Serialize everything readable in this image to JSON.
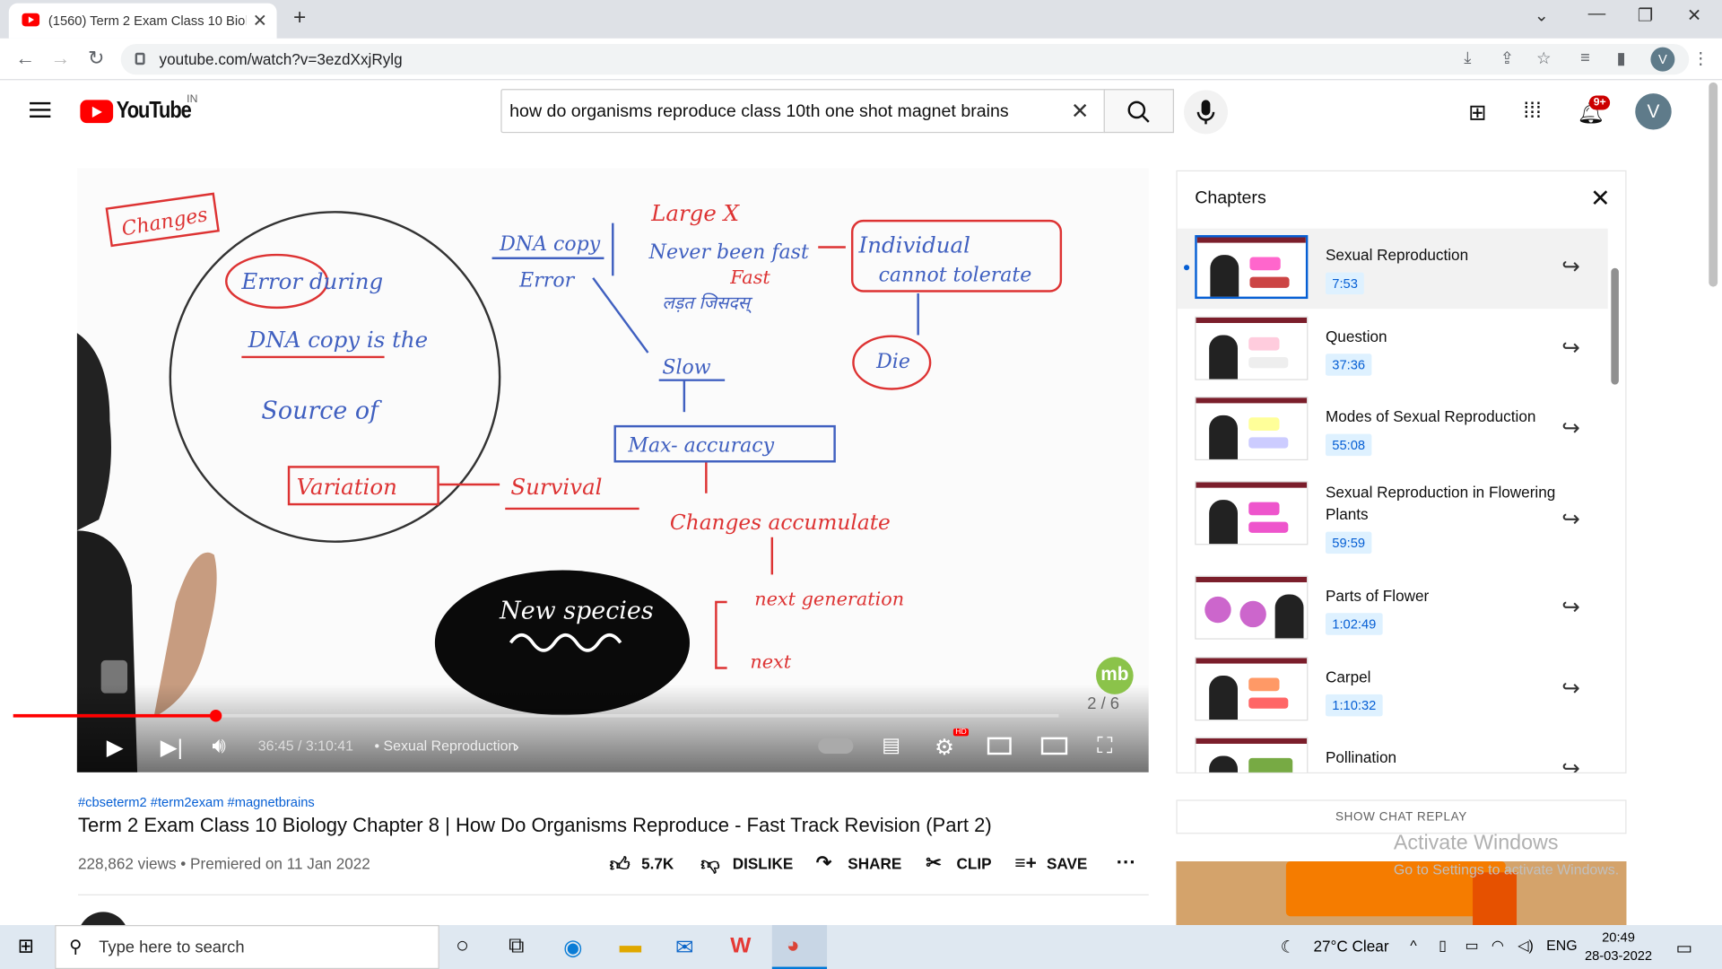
{
  "browser": {
    "tab_title": "(1560) Term 2 Exam Class 10 Biol",
    "url": "youtube.com/watch?v=3ezdXxjRylg",
    "profile_initial": "V"
  },
  "youtube": {
    "logo_text": "YouTube",
    "region": "IN",
    "search_query": "how do organisms reproduce class 10th one shot magnet brains",
    "notifications_badge": "9+",
    "avatar_initial": "V"
  },
  "player": {
    "time": "36:45 / 3:10:41",
    "chapter_label": "• Sexual Reproduction",
    "progress_fraction": 0.193,
    "watermark": "mb",
    "page_indicator": "2 / 6",
    "board_text": {
      "changes": "Changes",
      "error_during": "Error during",
      "dna_copy_is_the": "DNA copy is the",
      "source_of": "Source of",
      "variation": "Variation",
      "dna_copy": "DNA copy",
      "error": "Error",
      "large_x": "Large X",
      "never_been_fast": "Never been fast",
      "fast": "Fast",
      "hindi": "लड़त जिसदस्",
      "individual": "Individual",
      "cannot_tolerate": "cannot tolerate",
      "slow": "Slow",
      "die": "Die",
      "max_accuracy": "Max- accuracy",
      "survival": "Survival",
      "changes_accumulate": "Changes accumulate",
      "next_generation": "next generation",
      "next": "next",
      "new_species": "New species"
    }
  },
  "video": {
    "hashtags": "#cbseterm2 #term2exam #magnetbrains",
    "title": "Term 2 Exam Class 10 Biology Chapter 8 | How Do Organisms Reproduce - Fast Track Revision (Part 2)",
    "meta": "228,862 views • Premiered on 11 Jan 2022",
    "likes": "5.7K",
    "dislike": "DISLIKE",
    "share": "SHARE",
    "clip": "CLIP",
    "save": "SAVE"
  },
  "chapters": {
    "title": "Chapters",
    "items": [
      {
        "name": "Sexual Reproduction",
        "time": "7:53"
      },
      {
        "name": "Question",
        "time": "37:36"
      },
      {
        "name": "Modes of Sexual Reproduction",
        "time": "55:08"
      },
      {
        "name": "Sexual Reproduction in Flowering Plants",
        "time": "59:59"
      },
      {
        "name": "Parts of Flower",
        "time": "1:02:49"
      },
      {
        "name": "Carpel",
        "time": "1:10:32"
      },
      {
        "name": "Pollination",
        "time": ""
      }
    ]
  },
  "sidebar": {
    "chat_replay": "SHOW CHAT REPLAY",
    "activate_title": "Activate Windows",
    "activate_sub": "Go to Settings to activate Windows."
  },
  "taskbar": {
    "search_placeholder": "Type here to search",
    "weather": "27°C  Clear",
    "language": "ENG",
    "time": "20:49",
    "date": "28-03-2022"
  }
}
